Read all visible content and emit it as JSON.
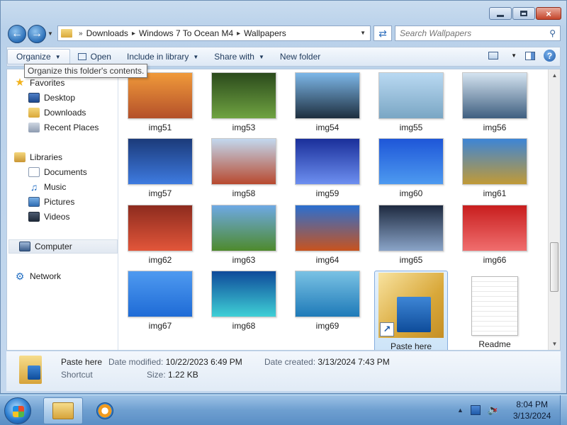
{
  "window": {
    "caption": {
      "minimize": "–",
      "maximize": "□",
      "close": "×"
    }
  },
  "address": {
    "crumbs": [
      "Downloads",
      "Windows 7 To Ocean M4",
      "Wallpapers"
    ],
    "separator": "»"
  },
  "search": {
    "placeholder": "Search Wallpapers"
  },
  "toolbar": {
    "organize": "Organize",
    "open": "Open",
    "include_in_library": "Include in library",
    "share_with": "Share with",
    "new_folder": "New folder",
    "help": "?"
  },
  "tooltip": {
    "text": "Organize this folder's contents."
  },
  "nav_pane": {
    "favorites": "Favorites",
    "desktop": "Desktop",
    "downloads": "Downloads",
    "recent_places": "Recent Places",
    "libraries": "Libraries",
    "documents": "Documents",
    "music": "Music",
    "pictures": "Pictures",
    "videos": "Videos",
    "computer": "Computer",
    "network": "Network"
  },
  "files": [
    {
      "name": "img51",
      "colors": [
        "#f09a3a",
        "#b4502a"
      ]
    },
    {
      "name": "img53",
      "colors": [
        "#2b4a1c",
        "#6fa341"
      ]
    },
    {
      "name": "img54",
      "colors": [
        "#7db7e8",
        "#1e2f3f"
      ]
    },
    {
      "name": "img55",
      "colors": [
        "#b9d9f2",
        "#7aa6c4"
      ]
    },
    {
      "name": "img56",
      "colors": [
        "#d4e3f0",
        "#3f5f80"
      ]
    },
    {
      "name": "img57",
      "colors": [
        "#1b3a7a",
        "#3e7be0"
      ]
    },
    {
      "name": "img58",
      "colors": [
        "#c2d8ee",
        "#b8492e"
      ]
    },
    {
      "name": "img59",
      "colors": [
        "#1a2f9a",
        "#6d8ff0"
      ]
    },
    {
      "name": "img60",
      "colors": [
        "#1e56d8",
        "#4d9af0"
      ]
    },
    {
      "name": "img61",
      "colors": [
        "#3d85d6",
        "#c19a36"
      ]
    },
    {
      "name": "img62",
      "colors": [
        "#8d2b1e",
        "#e2563a"
      ]
    },
    {
      "name": "img63",
      "colors": [
        "#6ea9e4",
        "#4e8a2c"
      ]
    },
    {
      "name": "img64",
      "colors": [
        "#2b6fd0",
        "#c8531e"
      ]
    },
    {
      "name": "img65",
      "colors": [
        "#1e2a40",
        "#8aa4c8"
      ]
    },
    {
      "name": "img66",
      "colors": [
        "#c81e1e",
        "#f06e6e"
      ]
    },
    {
      "name": "img67",
      "colors": [
        "#4f9af0",
        "#1e6bd6"
      ]
    },
    {
      "name": "img68",
      "colors": [
        "#0e4a9a",
        "#3fd0d6"
      ]
    },
    {
      "name": "img69",
      "colors": [
        "#7ac2e4",
        "#1e7ab8"
      ]
    },
    {
      "name": "Paste here",
      "selected": true
    },
    {
      "name": "Readme"
    }
  ],
  "details": {
    "name": "Paste here",
    "type": "Shortcut",
    "date_modified_label": "Date modified:",
    "date_modified": "10/22/2023 6:49 PM",
    "date_created_label": "Date created:",
    "date_created": "3/13/2024 7:43 PM",
    "size_label": "Size:",
    "size": "1.22 KB"
  },
  "taskbar": {
    "time": "8:04 PM",
    "date": "3/13/2024"
  }
}
